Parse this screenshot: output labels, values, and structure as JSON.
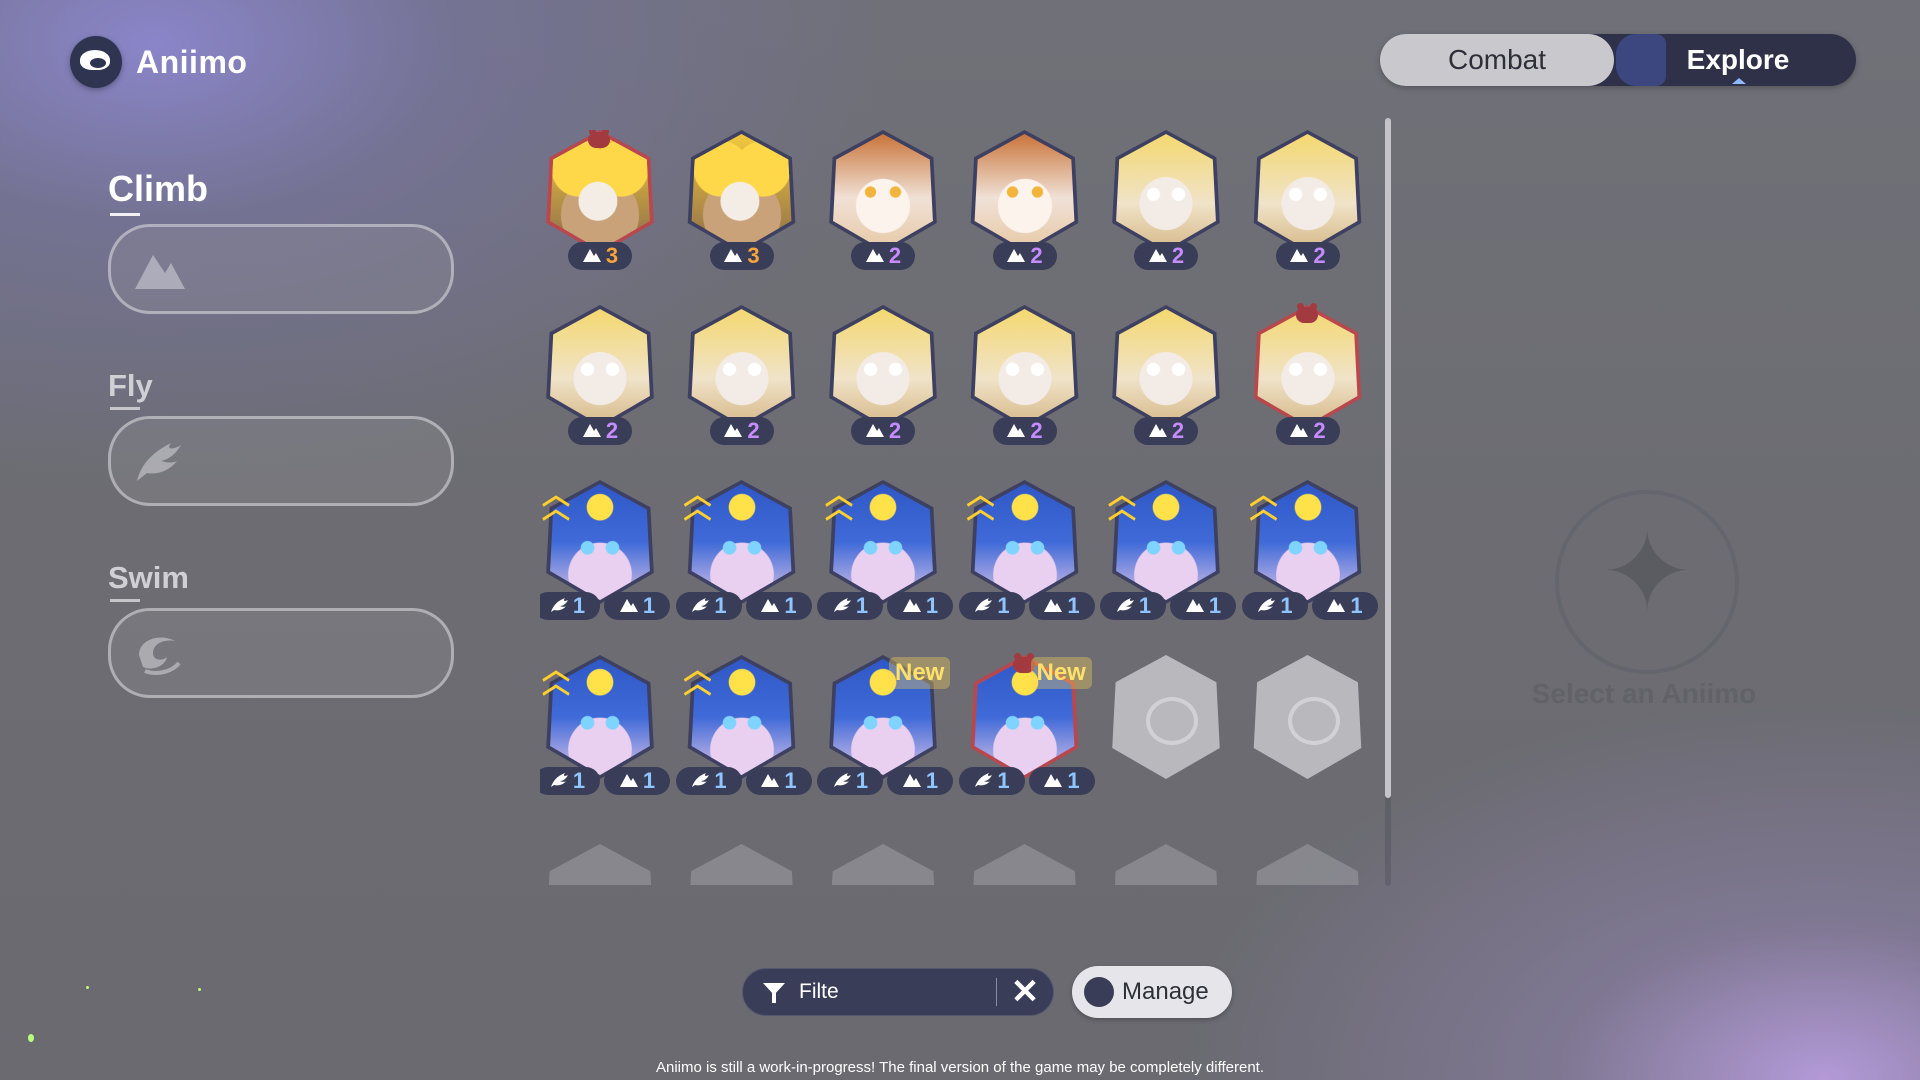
{
  "app": {
    "name": "Aniimo"
  },
  "mode": {
    "combat": "Combat",
    "explore": "Explore",
    "active": "Explore"
  },
  "skills": {
    "climb": "Climb",
    "fly": "Fly",
    "swim": "Swim"
  },
  "select_label": "Select an Aniimo",
  "icons": {
    "climb": "mountain-icon",
    "fly": "wing-icon",
    "swim": "wave-icon",
    "filter": "funnel-icon",
    "clear": "close-icon",
    "manage": "manage-icon"
  },
  "grid": [
    {
      "face": "fox",
      "marked": true,
      "climb": "3",
      "color": "orange"
    },
    {
      "face": "fox",
      "climb": "3",
      "color": "orange"
    },
    {
      "face": "calico",
      "climb": "2",
      "color": "purple"
    },
    {
      "face": "calico",
      "climb": "2",
      "color": "purple"
    },
    {
      "face": "cat",
      "climb": "2",
      "color": "purple"
    },
    {
      "face": "cat",
      "climb": "2",
      "color": "purple"
    },
    {
      "face": "cat",
      "climb": "2",
      "color": "purple"
    },
    {
      "face": "cat",
      "climb": "2",
      "color": "purple"
    },
    {
      "face": "cat",
      "climb": "2",
      "color": "purple"
    },
    {
      "face": "cat",
      "climb": "2",
      "color": "purple"
    },
    {
      "face": "cat",
      "climb": "2",
      "color": "purple"
    },
    {
      "face": "cat",
      "marked": true,
      "climb": "2",
      "color": "purple"
    },
    {
      "face": "blue",
      "rank": true,
      "fly": "1",
      "climb": "1"
    },
    {
      "face": "blue",
      "rank": true,
      "fly": "1",
      "climb": "1"
    },
    {
      "face": "blue",
      "rank": true,
      "fly": "1",
      "climb": "1"
    },
    {
      "face": "blue",
      "rank": true,
      "fly": "1",
      "climb": "1"
    },
    {
      "face": "blue",
      "rank": true,
      "fly": "1",
      "climb": "1"
    },
    {
      "face": "blue",
      "rank": true,
      "fly": "1",
      "climb": "1"
    },
    {
      "face": "blue",
      "rank": true,
      "fly": "1",
      "climb": "1"
    },
    {
      "face": "blue",
      "rank": true,
      "fly": "1",
      "climb": "1"
    },
    {
      "face": "blue",
      "new": "New",
      "fly": "1",
      "climb": "1"
    },
    {
      "face": "blue",
      "marked": true,
      "new": "New",
      "fly": "1",
      "climb": "1"
    },
    {
      "face": "empty"
    },
    {
      "face": "empty"
    },
    {
      "face": "ghost"
    },
    {
      "face": "ghost"
    },
    {
      "face": "ghost"
    },
    {
      "face": "ghost"
    },
    {
      "face": "ghost"
    },
    {
      "face": "ghost"
    }
  ],
  "filter": {
    "value": "Filte"
  },
  "manage": {
    "label": "Manage"
  },
  "disclaimer": "Aniimo is still a work-in-progress! The final version of the game may be completely different."
}
